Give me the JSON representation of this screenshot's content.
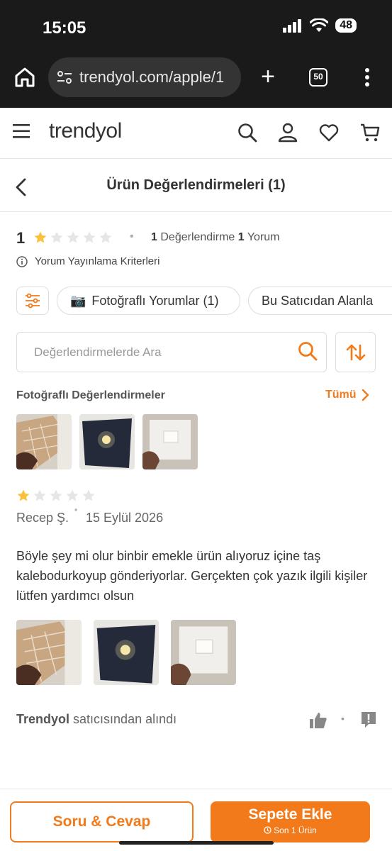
{
  "status_bar": {
    "time": "15:05",
    "battery": "48"
  },
  "browser": {
    "url": "trendyol.com/apple/1",
    "tab_count": "50"
  },
  "header": {
    "logo": "trendyol"
  },
  "page": {
    "title": "Ürün Değerlendirmeleri (1)"
  },
  "summary": {
    "rating": "1",
    "stars_filled": 1,
    "stars_total": 5,
    "review_count": "1",
    "review_label": "Değerlendirme",
    "comment_count": "1",
    "comment_label": "Yorum",
    "criteria": "Yorum Yayınlama Kriterleri"
  },
  "filters": {
    "photo_chip": "Fotoğraflı Yorumlar (1)",
    "photo_chip_emoji": "📷",
    "seller_chip": "Bu Satıcıdan Alanla"
  },
  "search": {
    "placeholder": "Değerlendirmelerde Ara"
  },
  "photo_section": {
    "title": "Fotoğraflı Değerlendirmeler",
    "see_all": "Tümü"
  },
  "review": {
    "stars_filled": 1,
    "author": "Recep Ş.",
    "date": "15 Eylül 2026",
    "text": "Böyle şey mi olur binbir emekle ürün alıyoruz içine taş kalebodurkoyup gönderiyorlar. Gerçekten çok yazık ilgili kişiler lütfen yardımcı olsun",
    "seller_name": "Trendyol",
    "seller_suffix": "satıcısından alındı"
  },
  "bottom": {
    "qa_label": "Soru & Cevap",
    "add_to_cart": "Sepete Ekle",
    "stock_note": "Son 1 Ürün"
  },
  "colors": {
    "accent": "#f27a1a",
    "star": "#f9c23c",
    "star_empty": "#e6e6e6"
  }
}
